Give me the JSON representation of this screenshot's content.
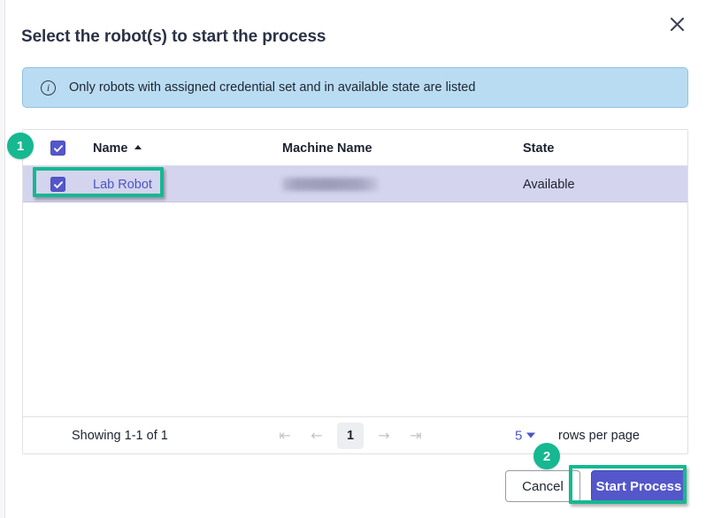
{
  "dialog": {
    "title": "Select the robot(s) to start the process",
    "close_icon": "close-icon"
  },
  "info_banner": {
    "icon": "info-circle-icon",
    "text": "Only robots with assigned credential set and in available state are listed",
    "bg_color": "#b9dcf2",
    "border_color": "#8ec2e4"
  },
  "table": {
    "columns": [
      {
        "key": "select",
        "label": ""
      },
      {
        "key": "name",
        "label": "Name",
        "sorted": "asc",
        "sort_icon": "caret-up-icon"
      },
      {
        "key": "machine",
        "label": "Machine Name"
      },
      {
        "key": "state",
        "label": "State"
      }
    ],
    "header_select_all_checked": true,
    "rows": [
      {
        "selected": true,
        "name": "Lab Robot",
        "machine": "",
        "machine_redacted": true,
        "state": "Available"
      }
    ],
    "selected_row_bg": "#d4d4ee"
  },
  "footer": {
    "showing": "Showing 1-1 of 1",
    "pagination": {
      "first_icon": "first-page-icon",
      "prev_icon": "previous-page-icon",
      "current_page": "1",
      "next_icon": "next-page-icon",
      "last_icon": "last-page-icon",
      "disabled": true
    },
    "rows_per_page": {
      "value": "5",
      "caret_icon": "chevron-down-icon",
      "label": "rows per page"
    }
  },
  "actions": {
    "cancel_label": "Cancel",
    "start_label": "Start Process",
    "primary_color": "#5457ca"
  },
  "annotations": {
    "badge_1": "1",
    "badge_2": "2",
    "highlight_color": "#15b891"
  }
}
